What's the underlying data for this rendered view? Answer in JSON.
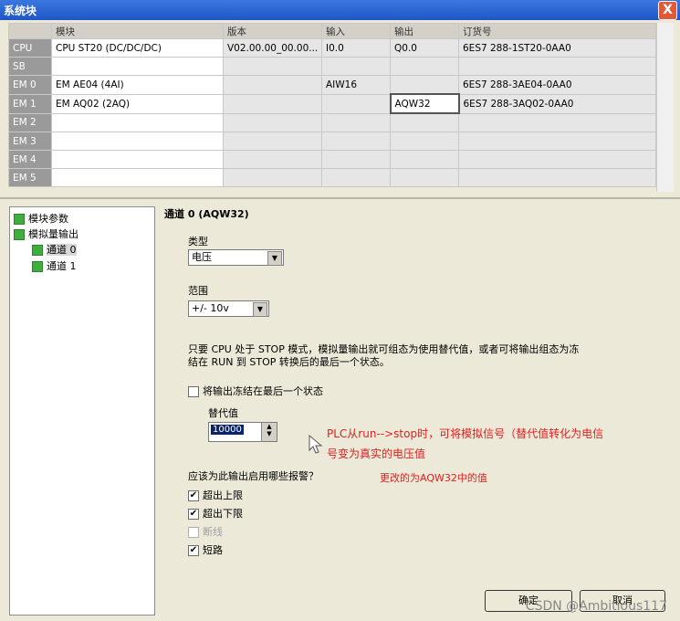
{
  "window": {
    "title": "系统块",
    "close_glyph": "X"
  },
  "grid": {
    "headers": [
      "模块",
      "版本",
      "输入",
      "输出",
      "订货号"
    ],
    "rows": [
      {
        "slot": "CPU",
        "module": "CPU ST20 (DC/DC/DC)",
        "version": "V02.00.00_00.00...",
        "input": "I0.0",
        "output": "Q0.0",
        "order": "6ES7 288-1ST20-0AA0"
      },
      {
        "slot": "SB",
        "module": "",
        "version": "",
        "input": "",
        "output": "",
        "order": ""
      },
      {
        "slot": "EM 0",
        "module": "EM AE04 (4AI)",
        "version": "",
        "input": "AIW16",
        "output": "",
        "order": "6ES7 288-3AE04-0AA0"
      },
      {
        "slot": "EM 1",
        "module": "EM AQ02 (2AQ)",
        "version": "",
        "input": "",
        "output": "AQW32",
        "order": "6ES7 288-3AQ02-0AA0"
      },
      {
        "slot": "EM 2",
        "module": "",
        "version": "",
        "input": "",
        "output": "",
        "order": ""
      },
      {
        "slot": "EM 3",
        "module": "",
        "version": "",
        "input": "",
        "output": "",
        "order": ""
      },
      {
        "slot": "EM 4",
        "module": "",
        "version": "",
        "input": "",
        "output": "",
        "order": ""
      },
      {
        "slot": "EM 5",
        "module": "",
        "version": "",
        "input": "",
        "output": "",
        "order": ""
      }
    ]
  },
  "tree": {
    "items": [
      "模块参数",
      "模拟量输出",
      "通道 0",
      "通道 1"
    ]
  },
  "panel": {
    "channel_title": "通道 0 (AQW32)",
    "type_label": "类型",
    "type_value": "电压",
    "range_label": "范围",
    "range_value": "+/- 10v",
    "desc_line1": "只要 CPU 处于 STOP 模式，模拟量输出就可组态为使用替代值，或者可将输出组态为冻",
    "desc_line2": "结在 RUN 到 STOP 转换后的最后一个状态。",
    "freeze_label": "将输出冻结在最后一个状态",
    "subst_label": "替代值",
    "subst_value": "10000",
    "alarms_label": "应该为此输出启用哪些报警？",
    "alarms": [
      {
        "label": "超出上限",
        "checked": true,
        "enabled": true
      },
      {
        "label": "超出下限",
        "checked": true,
        "enabled": true
      },
      {
        "label": "断线",
        "checked": false,
        "enabled": false
      },
      {
        "label": "短路",
        "checked": true,
        "enabled": true
      }
    ]
  },
  "annotation": {
    "line1": "PLC从run-->stop时，可将模拟信号（替代值转化为电信",
    "line2": "号变为真实的电压值",
    "line3": "更改的为AQW32中的值",
    "color": "#e02020"
  },
  "buttons": {
    "ok": "确定",
    "cancel": "取消"
  },
  "watermark": "CSDN @Ambitious117"
}
